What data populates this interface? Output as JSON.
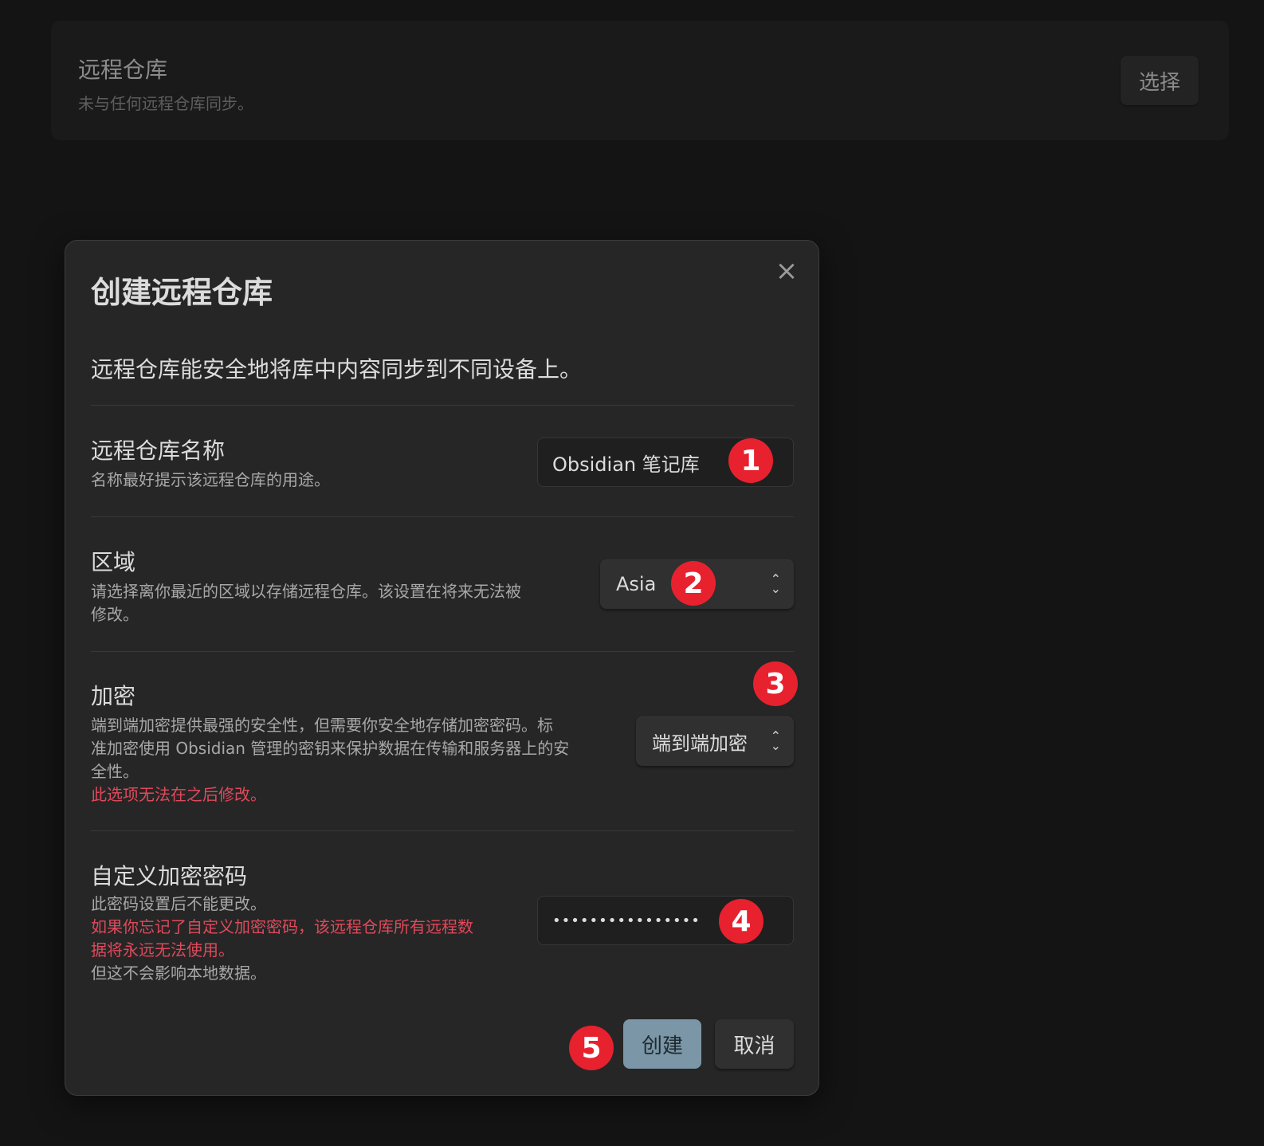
{
  "background_card": {
    "title": "远程仓库",
    "description": "未与任何远程仓库同步。",
    "select_button": "选择"
  },
  "modal": {
    "title": "创建远程仓库",
    "lead": "远程仓库能安全地将库中内容同步到不同设备上。",
    "name_setting": {
      "name": "远程仓库名称",
      "description": "名称最好提示该远程仓库的用途。",
      "value": "Obsidian 笔记库"
    },
    "region_setting": {
      "name": "区域",
      "description_line1": "请选择离你最近的区域以存储远程仓库。该设置在将来无法被",
      "description_line2": "修改。",
      "selected": "Asia"
    },
    "encryption_setting": {
      "name": "加密",
      "description_line1": "端到端加密提供最强的安全性，但需要你安全地存储加密密码。标",
      "description_line2": "准加密使用 Obsidian 管理的密钥来保护数据在传输和服务器上的安",
      "description_line3": "全性。",
      "warning": "此选项无法在之后修改。",
      "selected": "端到端加密"
    },
    "password_setting": {
      "name": "自定义加密密码",
      "description": "此密码设置后不能更改。",
      "warning_line1": "如果你忘记了自定义加密密码，该远程仓库所有远程数",
      "warning_line2": "据将永远无法使用。",
      "note": "但这不会影响本地数据。",
      "value": "••••••••••••••••"
    },
    "create_button": "创建",
    "cancel_button": "取消"
  },
  "annotations": [
    "1",
    "2",
    "3",
    "4",
    "5"
  ],
  "colors": {
    "badge": "#e8212f",
    "warning_text": "#e0495b",
    "primary_button": "#7b96a6"
  }
}
